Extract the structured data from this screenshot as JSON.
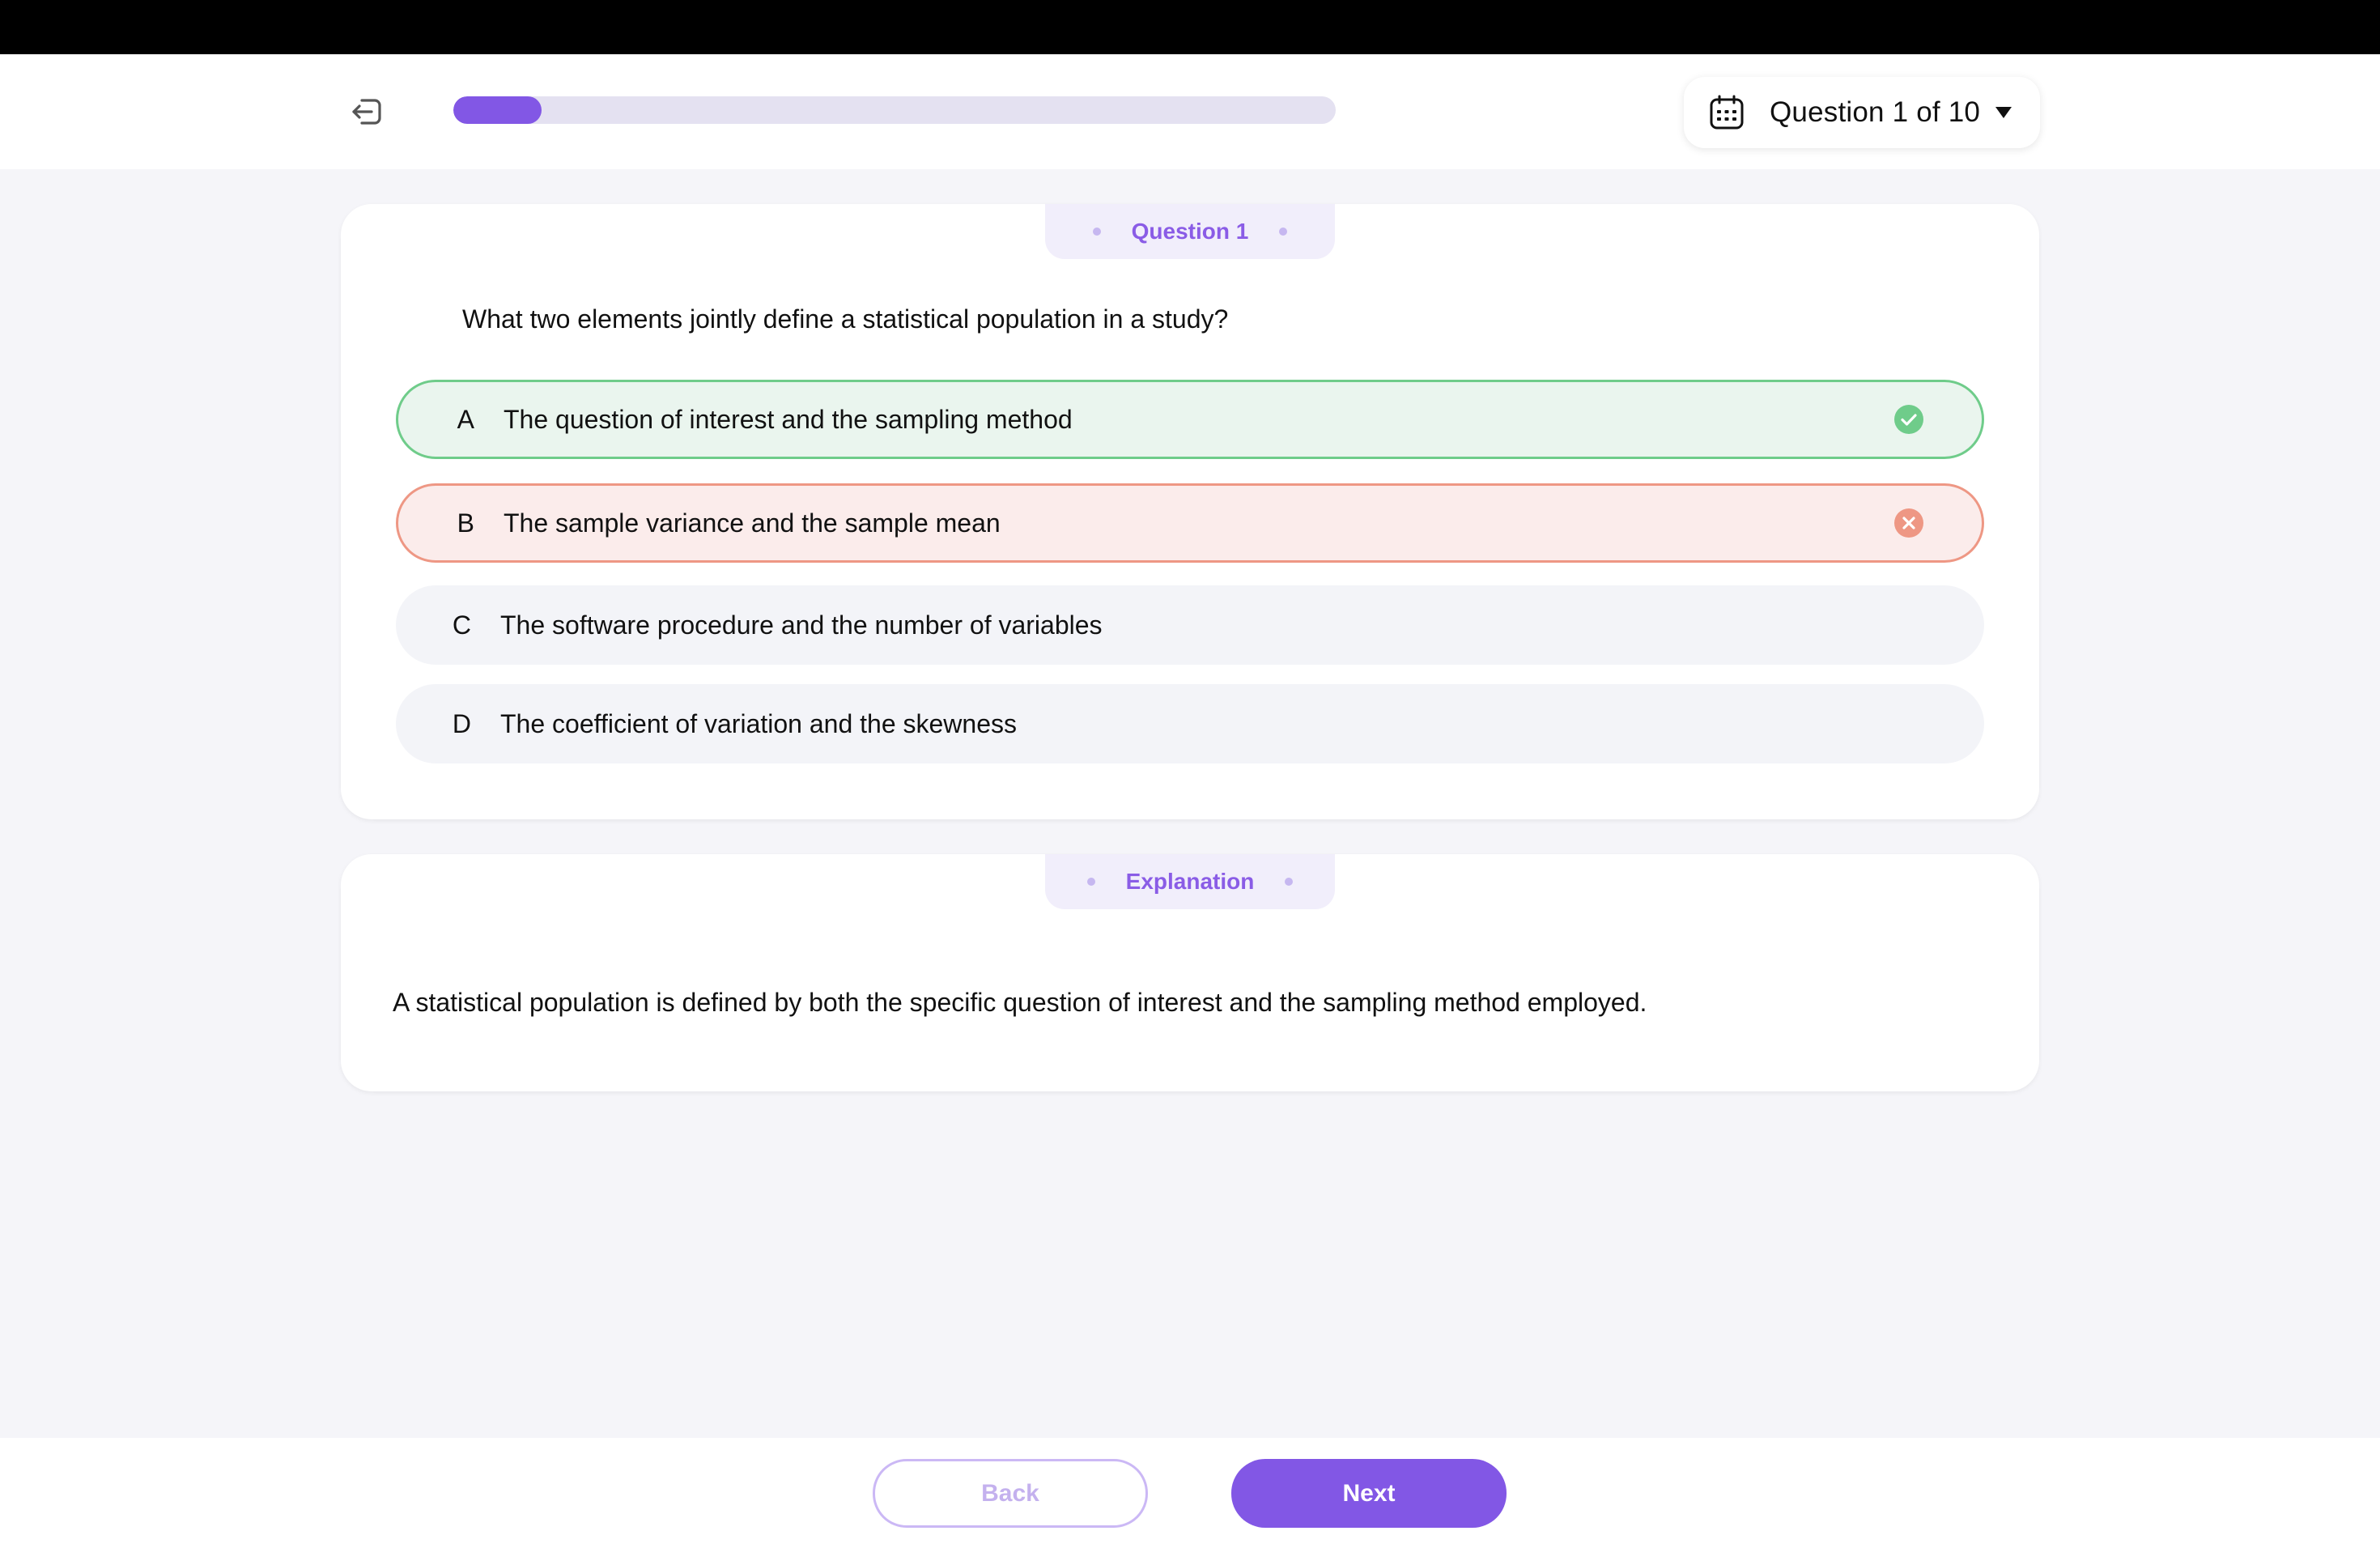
{
  "header": {
    "progress_percent": 10,
    "question_selector_label": "Question 1 of 10",
    "exit_icon": "exit-icon",
    "calendar_icon": "calendar-icon",
    "caret_icon": "caret-down-icon",
    "accent_color": "#8257e5"
  },
  "question_card": {
    "tab_label": "Question 1",
    "question": "What two elements jointly define a statistical population in a study?",
    "options": [
      {
        "letter": "A",
        "text": "The question of interest and the sampling method",
        "state": "correct"
      },
      {
        "letter": "B",
        "text": "The sample variance and the sample mean",
        "state": "incorrect"
      },
      {
        "letter": "C",
        "text": "The software procedure and the number of variables",
        "state": "neutral"
      },
      {
        "letter": "D",
        "text": "The coefficient of variation and the skewness",
        "state": "neutral"
      }
    ]
  },
  "explanation_card": {
    "tab_label": "Explanation",
    "text": "A statistical population is defined by both the specific question of interest and the sampling method employed."
  },
  "footer": {
    "back_label": "Back",
    "next_label": "Next"
  },
  "colors": {
    "correct_border": "#6fcc8a",
    "correct_bg": "#eaf5ee",
    "incorrect_border": "#ee9784",
    "incorrect_bg": "#fbeceb"
  }
}
